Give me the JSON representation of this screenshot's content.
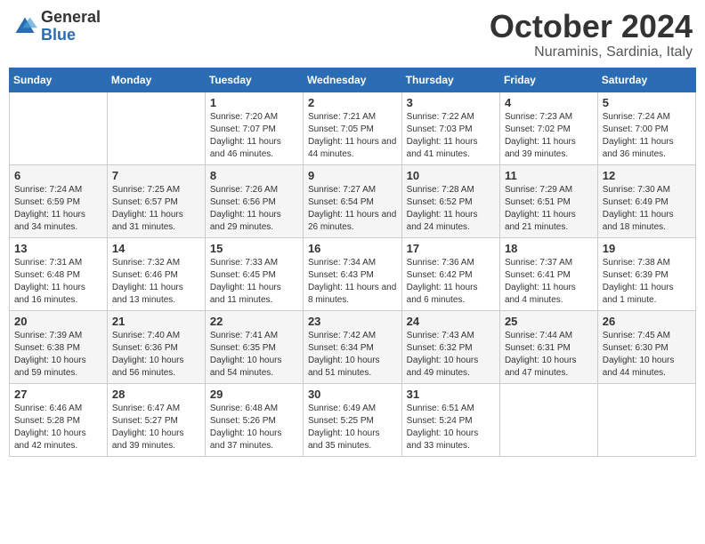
{
  "header": {
    "logo_general": "General",
    "logo_blue": "Blue",
    "title": "October 2024",
    "location": "Nuraminis, Sardinia, Italy"
  },
  "weekdays": [
    "Sunday",
    "Monday",
    "Tuesday",
    "Wednesday",
    "Thursday",
    "Friday",
    "Saturday"
  ],
  "weeks": [
    [
      null,
      null,
      {
        "day": "1",
        "sunrise": "7:20 AM",
        "sunset": "7:07 PM",
        "daylight": "11 hours and 46 minutes."
      },
      {
        "day": "2",
        "sunrise": "7:21 AM",
        "sunset": "7:05 PM",
        "daylight": "11 hours and 44 minutes."
      },
      {
        "day": "3",
        "sunrise": "7:22 AM",
        "sunset": "7:03 PM",
        "daylight": "11 hours and 41 minutes."
      },
      {
        "day": "4",
        "sunrise": "7:23 AM",
        "sunset": "7:02 PM",
        "daylight": "11 hours and 39 minutes."
      },
      {
        "day": "5",
        "sunrise": "7:24 AM",
        "sunset": "7:00 PM",
        "daylight": "11 hours and 36 minutes."
      }
    ],
    [
      {
        "day": "6",
        "sunrise": "7:24 AM",
        "sunset": "6:59 PM",
        "daylight": "11 hours and 34 minutes."
      },
      {
        "day": "7",
        "sunrise": "7:25 AM",
        "sunset": "6:57 PM",
        "daylight": "11 hours and 31 minutes."
      },
      {
        "day": "8",
        "sunrise": "7:26 AM",
        "sunset": "6:56 PM",
        "daylight": "11 hours and 29 minutes."
      },
      {
        "day": "9",
        "sunrise": "7:27 AM",
        "sunset": "6:54 PM",
        "daylight": "11 hours and 26 minutes."
      },
      {
        "day": "10",
        "sunrise": "7:28 AM",
        "sunset": "6:52 PM",
        "daylight": "11 hours and 24 minutes."
      },
      {
        "day": "11",
        "sunrise": "7:29 AM",
        "sunset": "6:51 PM",
        "daylight": "11 hours and 21 minutes."
      },
      {
        "day": "12",
        "sunrise": "7:30 AM",
        "sunset": "6:49 PM",
        "daylight": "11 hours and 18 minutes."
      }
    ],
    [
      {
        "day": "13",
        "sunrise": "7:31 AM",
        "sunset": "6:48 PM",
        "daylight": "11 hours and 16 minutes."
      },
      {
        "day": "14",
        "sunrise": "7:32 AM",
        "sunset": "6:46 PM",
        "daylight": "11 hours and 13 minutes."
      },
      {
        "day": "15",
        "sunrise": "7:33 AM",
        "sunset": "6:45 PM",
        "daylight": "11 hours and 11 minutes."
      },
      {
        "day": "16",
        "sunrise": "7:34 AM",
        "sunset": "6:43 PM",
        "daylight": "11 hours and 8 minutes."
      },
      {
        "day": "17",
        "sunrise": "7:36 AM",
        "sunset": "6:42 PM",
        "daylight": "11 hours and 6 minutes."
      },
      {
        "day": "18",
        "sunrise": "7:37 AM",
        "sunset": "6:41 PM",
        "daylight": "11 hours and 4 minutes."
      },
      {
        "day": "19",
        "sunrise": "7:38 AM",
        "sunset": "6:39 PM",
        "daylight": "11 hours and 1 minute."
      }
    ],
    [
      {
        "day": "20",
        "sunrise": "7:39 AM",
        "sunset": "6:38 PM",
        "daylight": "10 hours and 59 minutes."
      },
      {
        "day": "21",
        "sunrise": "7:40 AM",
        "sunset": "6:36 PM",
        "daylight": "10 hours and 56 minutes."
      },
      {
        "day": "22",
        "sunrise": "7:41 AM",
        "sunset": "6:35 PM",
        "daylight": "10 hours and 54 minutes."
      },
      {
        "day": "23",
        "sunrise": "7:42 AM",
        "sunset": "6:34 PM",
        "daylight": "10 hours and 51 minutes."
      },
      {
        "day": "24",
        "sunrise": "7:43 AM",
        "sunset": "6:32 PM",
        "daylight": "10 hours and 49 minutes."
      },
      {
        "day": "25",
        "sunrise": "7:44 AM",
        "sunset": "6:31 PM",
        "daylight": "10 hours and 47 minutes."
      },
      {
        "day": "26",
        "sunrise": "7:45 AM",
        "sunset": "6:30 PM",
        "daylight": "10 hours and 44 minutes."
      }
    ],
    [
      {
        "day": "27",
        "sunrise": "6:46 AM",
        "sunset": "5:28 PM",
        "daylight": "10 hours and 42 minutes."
      },
      {
        "day": "28",
        "sunrise": "6:47 AM",
        "sunset": "5:27 PM",
        "daylight": "10 hours and 39 minutes."
      },
      {
        "day": "29",
        "sunrise": "6:48 AM",
        "sunset": "5:26 PM",
        "daylight": "10 hours and 37 minutes."
      },
      {
        "day": "30",
        "sunrise": "6:49 AM",
        "sunset": "5:25 PM",
        "daylight": "10 hours and 35 minutes."
      },
      {
        "day": "31",
        "sunrise": "6:51 AM",
        "sunset": "5:24 PM",
        "daylight": "10 hours and 33 minutes."
      },
      null,
      null
    ]
  ],
  "labels": {
    "sunrise": "Sunrise:",
    "sunset": "Sunset:",
    "daylight": "Daylight:"
  }
}
